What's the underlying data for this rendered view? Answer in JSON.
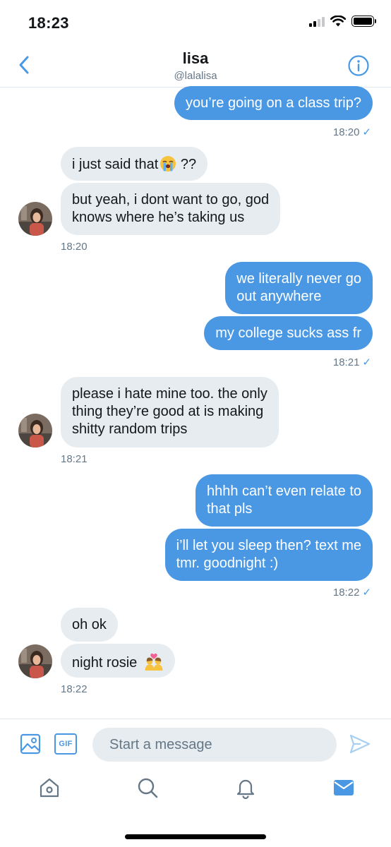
{
  "status_bar": {
    "time": "18:23"
  },
  "header": {
    "title": "lisa",
    "handle": "@lalalisa"
  },
  "conversation": {
    "messages": [
      {
        "from": "me",
        "text": "you’re going on a class trip?"
      },
      {
        "from": "them",
        "text": "i just said that",
        "emoji_after": "loudly-crying-face",
        "text_after": " ??"
      },
      {
        "from": "them",
        "lines": [
          "but yeah, i dont want to go, god",
          "knows where he’s taking us"
        ]
      },
      {
        "from": "me",
        "lines": [
          "we literally never go",
          "out anywhere"
        ]
      },
      {
        "from": "me",
        "text": "my college sucks ass fr"
      },
      {
        "from": "them",
        "lines": [
          "please i hate mine too. the only",
          "thing they’re good at is making",
          "shitty random trips"
        ]
      },
      {
        "from": "me",
        "lines": [
          "hhhh can’t even relate to",
          "that pls"
        ]
      },
      {
        "from": "me",
        "lines": [
          "i’ll let you sleep then? text me",
          "tmr. goodnight :)"
        ]
      },
      {
        "from": "them",
        "text": "oh ok"
      },
      {
        "from": "them",
        "text": "night rosie",
        "emoji_after": "couple-with-heart"
      }
    ],
    "timestamps": [
      "18:20",
      "18:20",
      "18:21",
      "18:21",
      "18:22",
      "18:22"
    ],
    "read_check": "✓"
  },
  "composer": {
    "placeholder": "Start a message",
    "gif_label": "GIF"
  },
  "colors": {
    "accent": "#4a98e4",
    "bubble_received": "#e6ecf0",
    "secondary_text": "#657786"
  }
}
